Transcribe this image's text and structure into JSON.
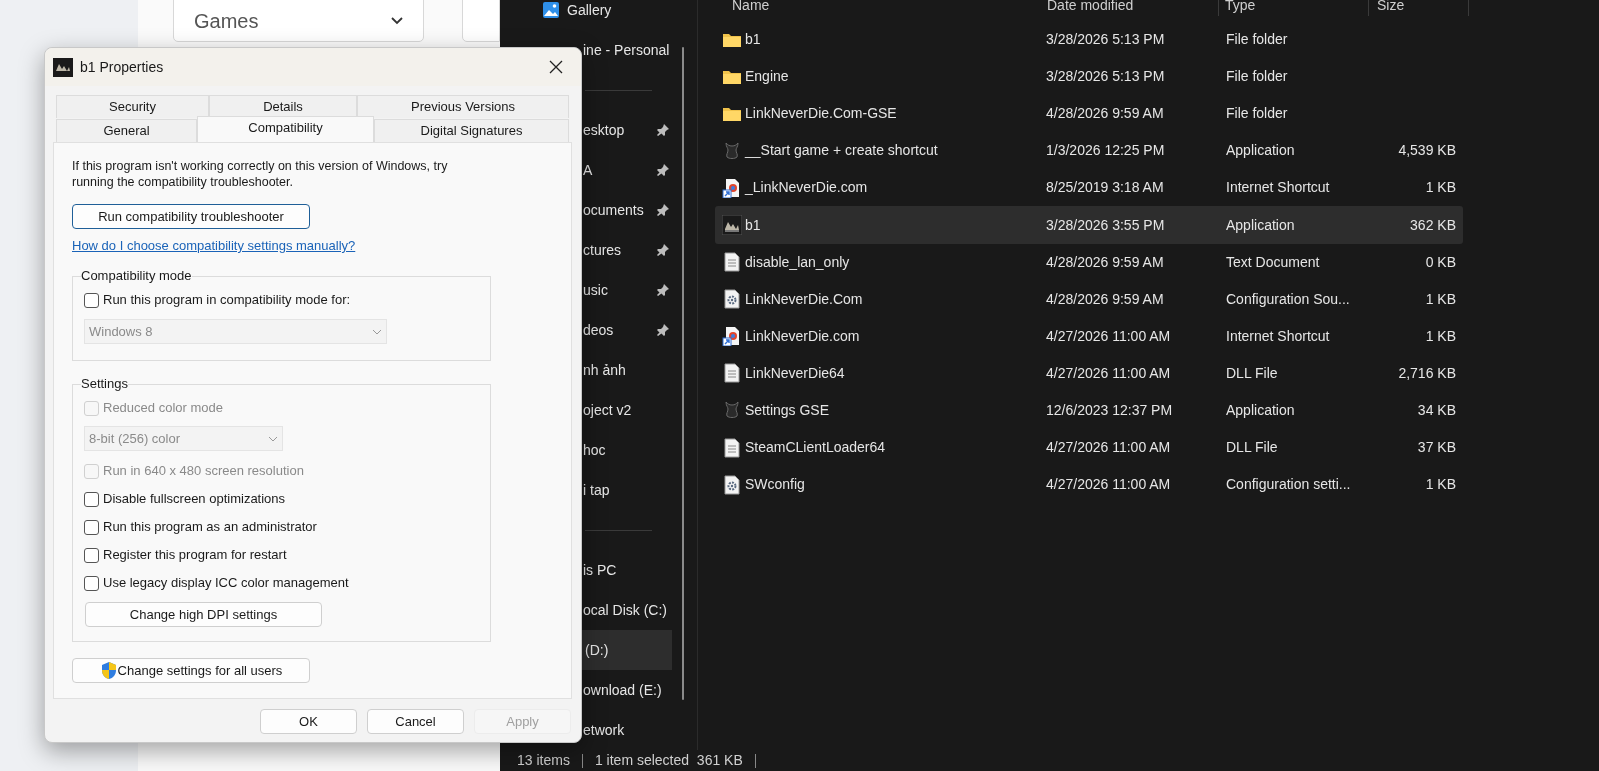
{
  "browser_page": {
    "dropdown": {
      "value": "Games"
    }
  },
  "explorer": {
    "sidebar": [
      {
        "items": [
          {
            "label": "Gallery",
            "pinned": false,
            "selected": false
          },
          {
            "label": "ine - Personal",
            "pinned": false,
            "selected": false
          }
        ]
      },
      {
        "items": [
          {
            "label": "esktop",
            "pinned": true,
            "selected": false
          },
          {
            "label": "A",
            "pinned": true,
            "selected": false
          },
          {
            "label": "ocuments",
            "pinned": true,
            "selected": false
          },
          {
            "label": "ctures",
            "pinned": true,
            "selected": false
          },
          {
            "label": "usic",
            "pinned": true,
            "selected": false
          },
          {
            "label": "deos",
            "pinned": true,
            "selected": false
          },
          {
            "label": "nh ảnh",
            "pinned": false,
            "selected": false
          },
          {
            "label": "oject v2",
            "pinned": false,
            "selected": false
          },
          {
            "label": "hoc",
            "pinned": false,
            "selected": false
          },
          {
            "label": "i tap",
            "pinned": false,
            "selected": false
          }
        ]
      },
      {
        "items": [
          {
            "label": "is PC",
            "pinned": false,
            "selected": false
          },
          {
            "label": "ocal Disk (C:)",
            "pinned": false,
            "selected": false
          },
          {
            "label": "(D:)",
            "pinned": false,
            "selected": true
          },
          {
            "label": "ownload (E:)",
            "pinned": false,
            "selected": false
          },
          {
            "label": "etwork",
            "pinned": false,
            "selected": false
          }
        ]
      }
    ],
    "columns": [
      "Name",
      "Date modified",
      "Type",
      "Size"
    ],
    "files": [
      {
        "name": "b1",
        "kind": "folder",
        "date": "3/28/2026 5:13 PM",
        "type": "File folder",
        "selected": false
      },
      {
        "name": "Engine",
        "kind": "folder",
        "date": "3/28/2026 5:13 PM",
        "type": "File folder",
        "selected": false
      },
      {
        "name": "LinkNeverDie.Com-GSE",
        "kind": "folder",
        "date": "4/28/2026 9:59 AM",
        "type": "File folder",
        "selected": false
      },
      {
        "name": "__Start game + create shortcut",
        "kind": "app_dark",
        "date": "1/3/2026 12:25 PM",
        "type": "Application",
        "size": "4,539 KB",
        "selected": false
      },
      {
        "name": "_LinkNeverDie.com",
        "kind": "link",
        "date": "8/25/2019 3:18 AM",
        "type": "Internet Shortcut",
        "size": "1 KB",
        "selected": false
      },
      {
        "name": "b1",
        "kind": "app_image",
        "date": "3/28/2026 3:55 PM",
        "type": "Application",
        "size": "362 KB",
        "selected": true
      },
      {
        "name": "disable_lan_only",
        "kind": "text",
        "date": "4/28/2026 9:59 AM",
        "type": "Text Document",
        "size": "0 KB",
        "selected": false
      },
      {
        "name": "LinkNeverDie.Com",
        "kind": "config",
        "date": "4/28/2026 9:59 AM",
        "type": "Configuration Sou...",
        "size": "1 KB",
        "selected": false
      },
      {
        "name": "LinkNeverDie.com",
        "kind": "link",
        "date": "4/27/2026 11:00 AM",
        "type": "Internet Shortcut",
        "size": "1 KB",
        "selected": false
      },
      {
        "name": "LinkNeverDie64",
        "kind": "text",
        "date": "4/27/2026 11:00 AM",
        "type": "DLL File",
        "size": "2,716 KB",
        "selected": false
      },
      {
        "name": "Settings GSE",
        "kind": "app_dark",
        "date": "12/6/2023 12:37 PM",
        "type": "Application",
        "size": "34 KB",
        "selected": false
      },
      {
        "name": "SteamCLientLoader64",
        "kind": "text",
        "date": "4/27/2026 11:00 AM",
        "type": "DLL File",
        "size": "37 KB",
        "selected": false
      },
      {
        "name": "SWconfig",
        "kind": "config",
        "date": "4/27/2026 11:00 AM",
        "type": "Configuration setti...",
        "size": "1 KB",
        "selected": false
      }
    ],
    "status_bar": {
      "count": "13 items",
      "selection": "1 item selected  361 KB"
    }
  },
  "dialog": {
    "title": "b1 Properties",
    "tab_rows": [
      {
        "tabs": [
          {
            "label": "Security",
            "selected": false
          },
          {
            "label": "Details",
            "selected": false
          },
          {
            "label": "Previous Versions",
            "selected": false
          }
        ]
      },
      {
        "tabs": [
          {
            "label": "General",
            "selected": false
          },
          {
            "label": "Compatibility",
            "selected": true
          },
          {
            "label": "Digital Signatures",
            "selected": false
          }
        ]
      }
    ],
    "intro": "If this program isn't working correctly on this version of Windows, try running the compatibility troubleshooter.",
    "troubleshooter_button": "Run compatibility troubleshooter",
    "help_link": "How do I choose compatibility settings manually?",
    "groups": [
      {
        "title": "Compatibility mode",
        "items": [
          {
            "kind": "checkbox",
            "label": "Run this program in compatibility mode for:",
            "checked": false,
            "disabled": false
          },
          {
            "kind": "dropdown",
            "value": "Windows 8",
            "disabled": true,
            "wide": true
          }
        ]
      },
      {
        "title": "Settings",
        "items": [
          {
            "kind": "checkbox",
            "label": "Reduced color mode",
            "checked": false,
            "disabled": true
          },
          {
            "kind": "dropdown",
            "value": "8-bit (256) color",
            "disabled": true,
            "wide": false
          },
          {
            "kind": "checkbox",
            "label": "Run in 640 x 480 screen resolution",
            "checked": false,
            "disabled": true
          },
          {
            "kind": "checkbox",
            "label": "Disable fullscreen optimizations",
            "checked": false,
            "disabled": false
          },
          {
            "kind": "checkbox",
            "label": "Run this program as an administrator",
            "checked": false,
            "disabled": false
          },
          {
            "kind": "checkbox",
            "label": "Register this program for restart",
            "checked": false,
            "disabled": false
          },
          {
            "kind": "checkbox",
            "label": "Use legacy display ICC color management",
            "checked": false,
            "disabled": false
          },
          {
            "kind": "button",
            "label": "Change high DPI settings"
          }
        ]
      }
    ],
    "all_users_button": "Change settings for all users",
    "buttons": [
      {
        "label": "OK",
        "disabled": false
      },
      {
        "label": "Cancel",
        "disabled": false
      },
      {
        "label": "Apply",
        "disabled": true
      }
    ]
  }
}
